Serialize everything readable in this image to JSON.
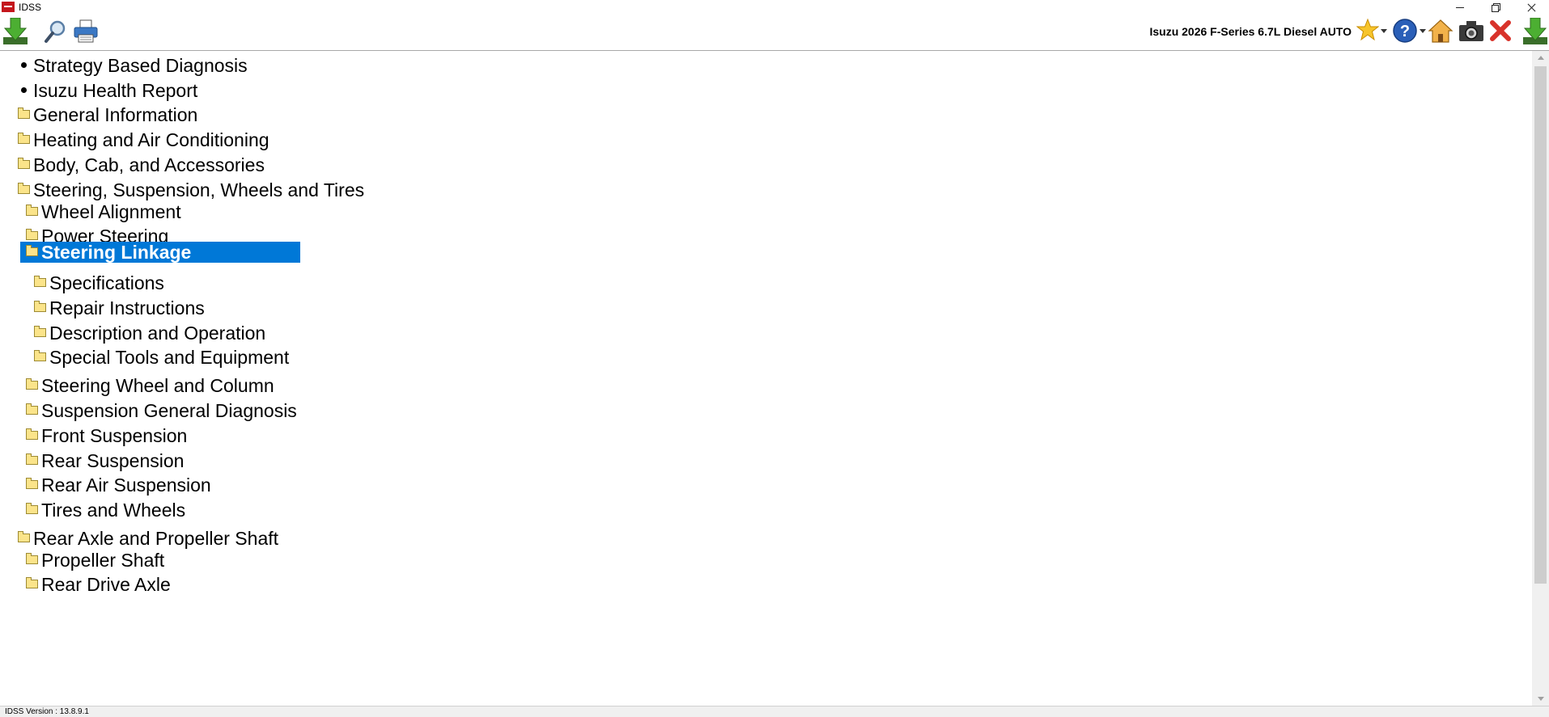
{
  "window": {
    "title": "IDSS"
  },
  "toolbar": {
    "vehicle": "Isuzu 2026 F-Series 6.7L Diesel AUTO",
    "icons": [
      "download-icon",
      "search-icon",
      "print-icon",
      "favorites-star-icon",
      "help-icon",
      "home-icon",
      "camera-icon",
      "close-icon",
      "download-icon"
    ]
  },
  "tree": {
    "items": [
      {
        "label": "Strategy Based Diagnosis",
        "type": "bullet",
        "level": 0
      },
      {
        "label": "Isuzu Health Report",
        "type": "bullet",
        "level": 0
      },
      {
        "label": "General Information",
        "type": "folder",
        "level": 0
      },
      {
        "label": "Heating and Air Conditioning",
        "type": "folder",
        "level": 0
      },
      {
        "label": "Body, Cab, and Accessories",
        "type": "folder",
        "level": 0
      },
      {
        "label": "Steering, Suspension, Wheels and Tires",
        "type": "folder-open",
        "level": 0
      },
      {
        "label": "Wheel Alignment",
        "type": "folder",
        "level": 1
      },
      {
        "label": "Power Steering",
        "type": "folder",
        "level": 1
      },
      {
        "label": "Steering Linkage",
        "type": "folder-open",
        "level": 1,
        "selected": true
      },
      {
        "label": "Specifications",
        "type": "folder",
        "level": 2
      },
      {
        "label": "Repair Instructions",
        "type": "folder",
        "level": 2
      },
      {
        "label": "Description and Operation",
        "type": "folder",
        "level": 2
      },
      {
        "label": "Special Tools and Equipment",
        "type": "folder",
        "level": 2
      },
      {
        "label": "Steering Wheel and Column",
        "type": "folder",
        "level": 1
      },
      {
        "label": "Suspension General Diagnosis",
        "type": "folder",
        "level": 1
      },
      {
        "label": "Front Suspension",
        "type": "folder",
        "level": 1
      },
      {
        "label": "Rear Suspension",
        "type": "folder",
        "level": 1
      },
      {
        "label": "Rear Air Suspension",
        "type": "folder",
        "level": 1
      },
      {
        "label": "Tires and Wheels",
        "type": "folder",
        "level": 1
      },
      {
        "label": "Rear Axle and Propeller Shaft",
        "type": "folder-open",
        "level": 0
      },
      {
        "label": "Propeller Shaft",
        "type": "folder",
        "level": 1
      },
      {
        "label": "Rear Drive Axle",
        "type": "folder",
        "level": 1
      }
    ]
  },
  "status": {
    "version": "IDSS Version : 13.8.9.1"
  },
  "colors": {
    "selection": "#0078d7",
    "folder": "#fbe48a"
  }
}
